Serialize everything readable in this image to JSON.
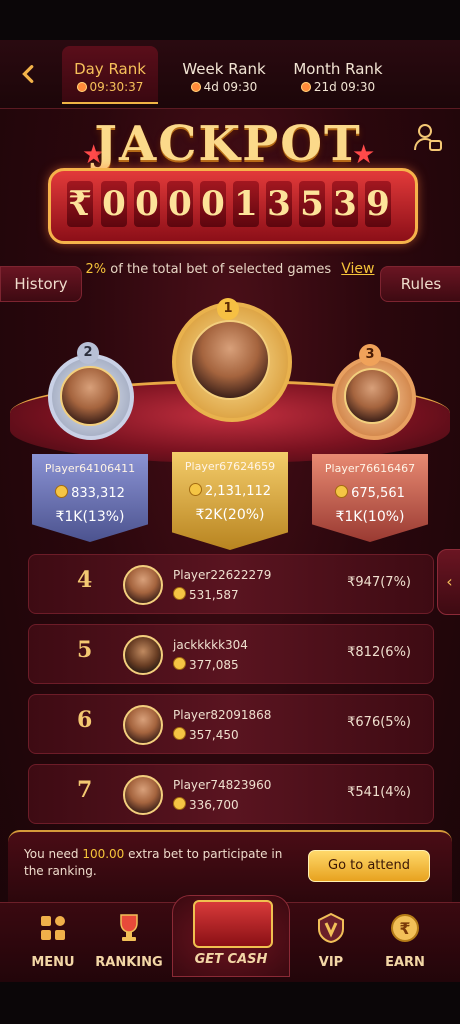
{
  "tabs": [
    {
      "label": "Day Rank",
      "time": "09:30:37",
      "active": true
    },
    {
      "label": "Week Rank",
      "time": "4d 09:30",
      "active": false
    },
    {
      "label": "Month Rank",
      "time": "21d 09:30",
      "active": false
    }
  ],
  "jackpot": {
    "title": "JACKPOT",
    "currency": "₹",
    "digits": [
      "0",
      "0",
      "0",
      "0",
      "1",
      "3",
      "5",
      "3",
      "9"
    ]
  },
  "info": {
    "percent": "2%",
    "text": "of the total bet of selected games",
    "view_label": "View"
  },
  "buttons": {
    "history": "History",
    "rules": "Rules"
  },
  "podium": [
    {
      "rank": "2",
      "name": "Player64106411",
      "coins": "833,312",
      "prize": "₹1K(13%)"
    },
    {
      "rank": "1",
      "name": "Player67624659",
      "coins": "2,131,112",
      "prize": "₹2K(20%)"
    },
    {
      "rank": "3",
      "name": "Player76616467",
      "coins": "675,561",
      "prize": "₹1K(10%)"
    }
  ],
  "rows": [
    {
      "rank": "4",
      "name": "Player22622279",
      "coins": "531,587",
      "prize": "₹947(7%)"
    },
    {
      "rank": "5",
      "name": "jackkkkk304",
      "coins": "377,085",
      "prize": "₹812(6%)"
    },
    {
      "rank": "6",
      "name": "Player82091868",
      "coins": "357,450",
      "prize": "₹676(5%)"
    },
    {
      "rank": "7",
      "name": "Player74823960",
      "coins": "336,700",
      "prize": "₹541(4%)"
    }
  ],
  "notice": {
    "prefix": "You need",
    "amount": "100.00",
    "suffix": "extra bet to participate in the ranking.",
    "button": "Go to attend"
  },
  "nav": {
    "menu": "MENU",
    "ranking": "RANKING",
    "getcash": "GET CASH",
    "vip": "VIP",
    "earn": "EARN"
  },
  "colors": {
    "accent_gold": "#f6c43a",
    "background": "#2b070d"
  }
}
